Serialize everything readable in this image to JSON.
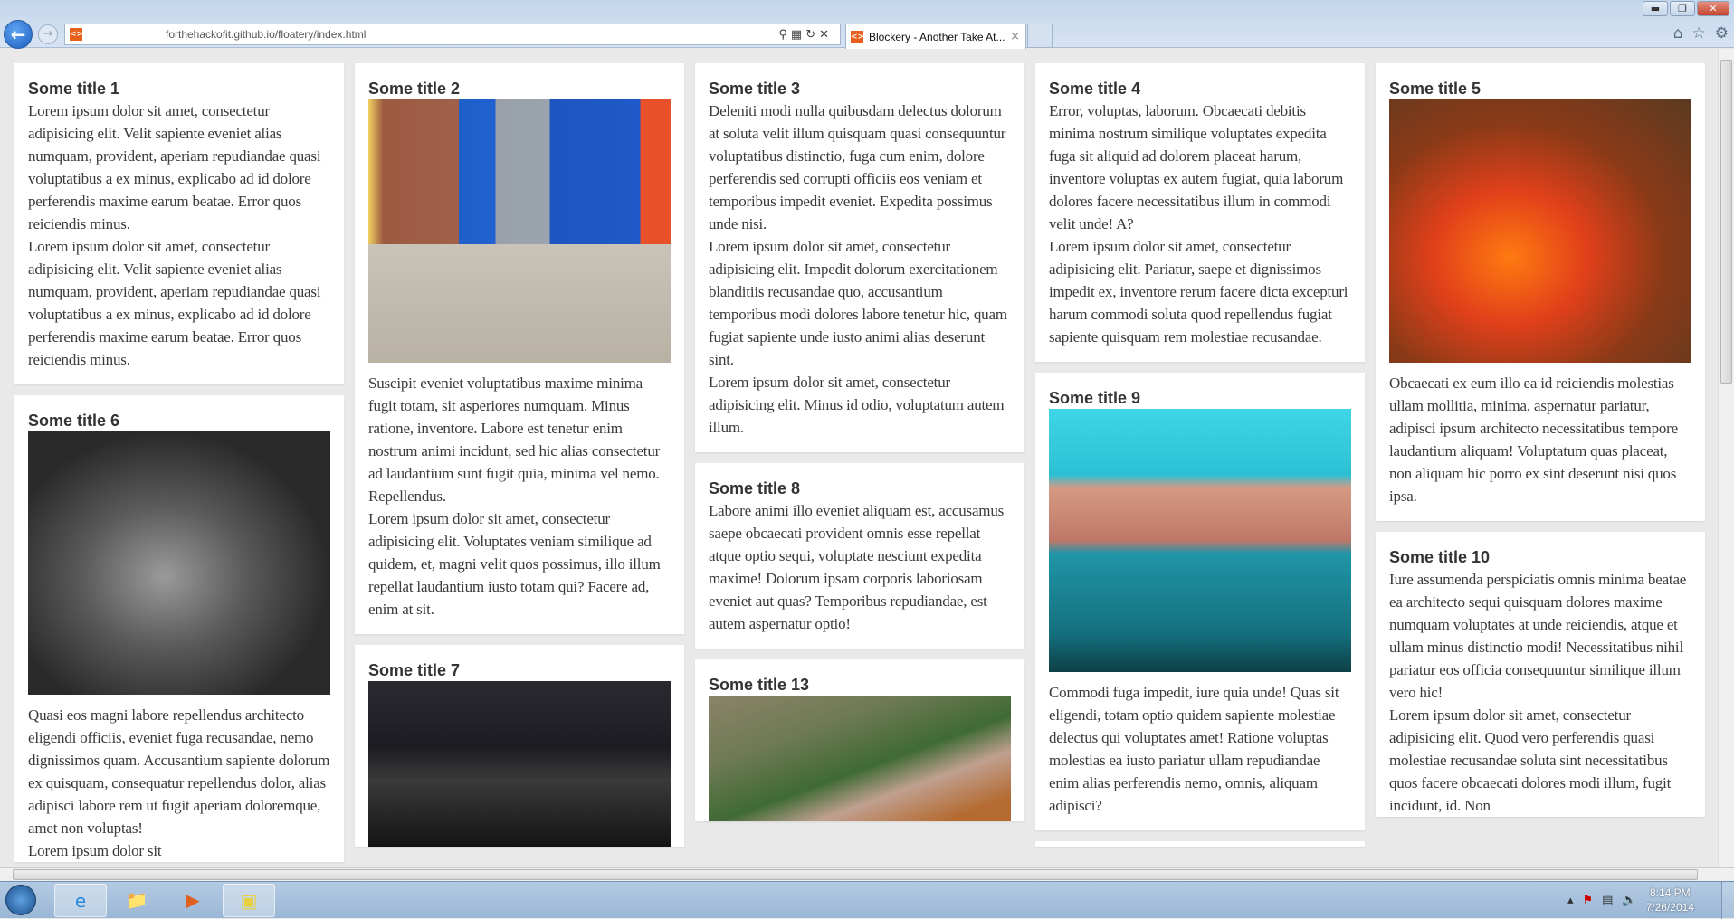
{
  "browser": {
    "url": "forthehackofit.github.io/floatery/index.html",
    "tab_title": "Blockery - Another Take At...",
    "icons": [
      "back-arrow-icon",
      "forward-arrow-icon",
      "search-icon",
      "refresh-icon",
      "stop-icon",
      "home-icon",
      "star-icon",
      "gear-icon"
    ]
  },
  "cards": {
    "c1": {
      "title": "Some title 1",
      "paras": [
        "Lorem ipsum dolor sit amet, consectetur adipisicing elit. Velit sapiente eveniet alias numquam, provident, aperiam repudiandae quasi voluptatibus a ex minus, explicabo ad id dolore perferendis maxime earum beatae. Error quos reiciendis minus.",
        "Lorem ipsum dolor sit amet, consectetur adipisicing elit. Velit sapiente eveniet alias numquam, provident, aperiam repudiandae quasi voluptatibus a ex minus, explicabo ad id dolore perferendis maxime earum beatae. Error quos reiciendis minus."
      ]
    },
    "c6": {
      "title": "Some title 6",
      "paras": [
        "Quasi eos magni labore repellendus architecto eligendi officiis, eveniet fuga recusandae, nemo dignissimos quam. Accusantium sapiente dolorum ex quisquam, consequatur repellendus dolor, alias adipisci labore rem ut fugit aperiam doloremque, amet non voluptas!",
        "Lorem ipsum dolor sit"
      ]
    },
    "c2": {
      "title": "Some title 2",
      "paras": [
        "Suscipit eveniet voluptatibus maxime minima fugit totam, sit asperiores numquam. Minus ratione, inventore. Labore est tenetur enim nostrum animi incidunt, sed hic alias consectetur ad laudantium sunt fugit quia, minima vel nemo. Repellendus.",
        "Lorem ipsum dolor sit amet, consectetur adipisicing elit. Voluptates veniam similique ad quidem, et, magni velit quos possimus, illo illum repellat laudantium iusto totam qui? Facere ad, enim at sit."
      ]
    },
    "c7": {
      "title": "Some title 7"
    },
    "c3": {
      "title": "Some title 3",
      "paras": [
        "Deleniti modi nulla quibusdam delectus dolorum at soluta velit illum quisquam quasi consequuntur voluptatibus distinctio, fuga cum enim, dolore perferendis sed corrupti officiis eos veniam et temporibus impedit eveniet. Expedita possimus unde nisi.",
        "Lorem ipsum dolor sit amet, consectetur adipisicing elit. Impedit dolorum exercitationem blanditiis recusandae quo, accusantium temporibus modi dolores labore tenetur hic, quam fugiat sapiente unde iusto animi alias deserunt sint.",
        "Lorem ipsum dolor sit amet, consectetur adipisicing elit. Minus id odio, voluptatum autem illum."
      ]
    },
    "c8": {
      "title": "Some title 8",
      "paras": [
        "Labore animi illo eveniet aliquam est, accusamus saepe obcaecati provident omnis esse repellat atque optio sequi, voluptate nesciunt expedita maxime! Dolorum ipsam corporis laboriosam eveniet aut quas? Temporibus repudiandae, est autem aspernatur optio!"
      ]
    },
    "c13": {
      "title": "Some title 13"
    },
    "c4": {
      "title": "Some title 4",
      "paras": [
        "Error, voluptas, laborum. Obcaecati debitis minima nostrum similique voluptates expedita fuga sit aliquid ad dolorem placeat harum, inventore voluptas ex autem fugiat, quia laborum dolores facere necessitatibus illum in commodi velit unde! A?",
        "Lorem ipsum dolor sit amet, consectetur adipisicing elit. Pariatur, saepe et dignissimos impedit ex, inventore rerum facere dicta excepturi harum commodi soluta quod repellendus fugiat sapiente quisquam rem molestiae recusandae."
      ]
    },
    "c9": {
      "title": "Some title 9",
      "paras": [
        "Commodi fuga impedit, iure quia unde! Quas sit eligendi, totam optio quidem sapiente molestiae delectus qui voluptates amet! Ratione voluptas molestias ea iusto pariatur ullam repudiandae enim alias perferendis nemo, omnis, aliquam adipisci?"
      ]
    },
    "c5": {
      "title": "Some title 5",
      "paras": [
        "Obcaecati ex eum illo ea id reiciendis molestias ullam mollitia, minima, aspernatur pariatur, adipisci ipsum architecto necessitatibus tempore laudantium aliquam! Voluptatum quas placeat, non aliquam hic porro ex sint deserunt nisi quos ipsa."
      ]
    },
    "c10": {
      "title": "Some title 10",
      "paras": [
        "Iure assumenda perspiciatis omnis minima beatae ea architecto sequi quisquam dolores maxime numquam voluptates at unde reiciendis, atque et ullam minus distinctio modi! Necessitatibus nihil pariatur eos officia consequuntur similique illum vero hic!",
        "Lorem ipsum dolor sit amet, consectetur adipisicing elit. Quod vero perferendis quasi molestiae recusandae soluta sint necessitatibus quos facere obcaecati dolores modi illum, fugit incidunt, id. Non"
      ]
    }
  },
  "taskbar": {
    "time": "8:14 PM",
    "date": "7/26/2014",
    "apps": [
      "internet-explorer",
      "file-explorer",
      "media-player",
      "sticky-notes"
    ]
  }
}
